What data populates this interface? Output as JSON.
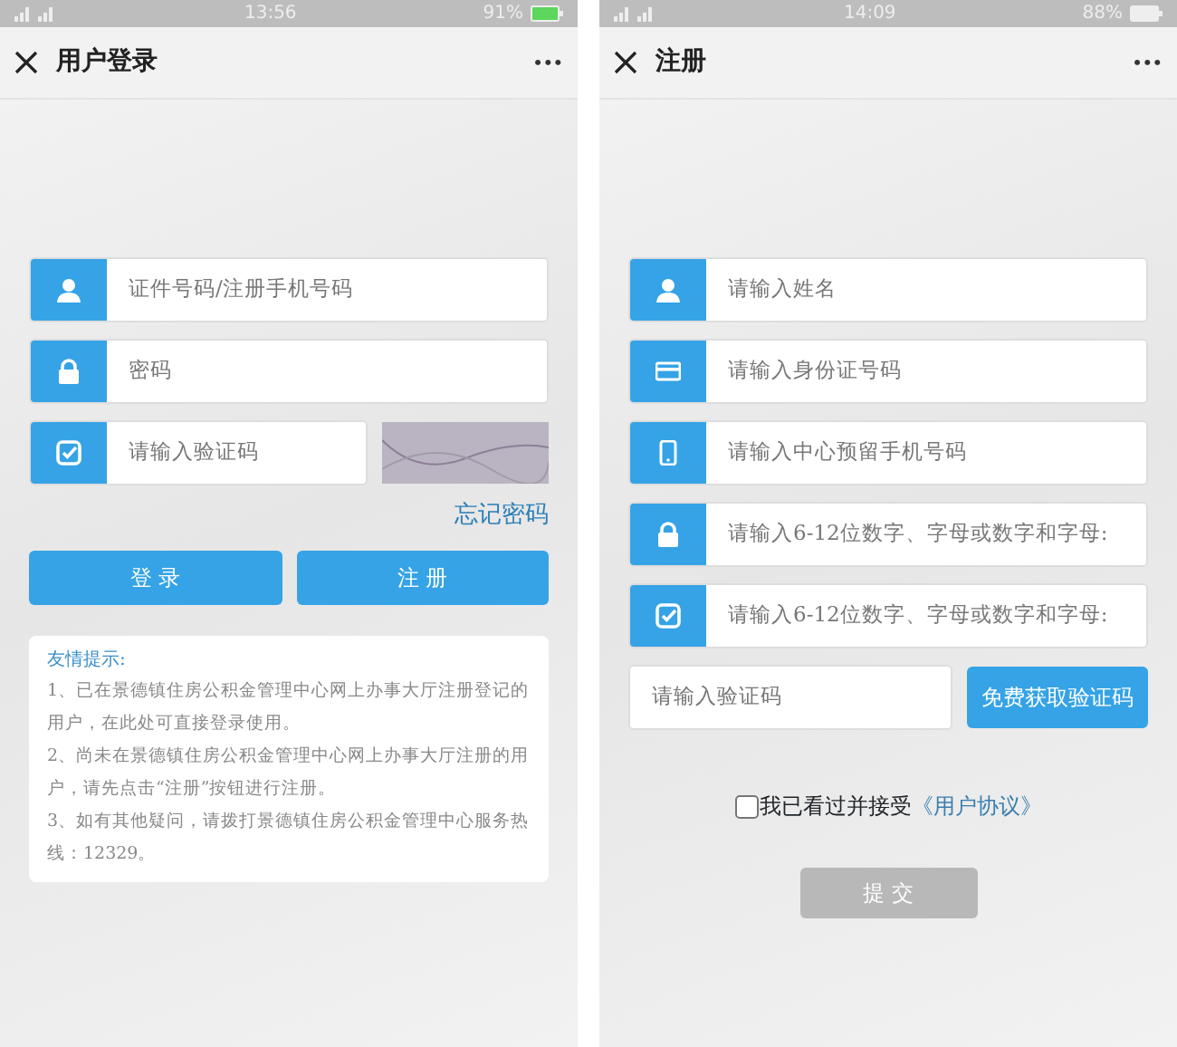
{
  "screens": [
    {
      "status_bar": {
        "time": "13:56",
        "battery": "91%"
      },
      "title": "用户登录",
      "menu": "···",
      "fields": [
        {
          "kind": "user",
          "placeholder": "证件号码/注册手机号码"
        },
        {
          "kind": "lock",
          "placeholder": "密码"
        },
        {
          "kind": "check",
          "placeholder": "请输入验证码",
          "captcha": true
        }
      ],
      "forgot_link": "忘记密码",
      "buttons": [
        {
          "label": "登 录"
        },
        {
          "label": "注 册"
        }
      ],
      "tips": {
        "heading": "友情提示:",
        "lines": [
          "1、已在景德镇住房公积金管理中心网上办事大厅注册登记的用户，在此处可直接登录使用。",
          "2、尚未在景德镇住房公积金管理中心网上办事大厅注册的用户，请先点击“注册”按钮进行注册。",
          "3、如有其他疑问，请拨打景德镇住房公积金管理中心服务热线：12329。"
        ]
      }
    },
    {
      "status_bar": {
        "time": "14:09",
        "battery": "88%"
      },
      "title": "注册",
      "menu": "···",
      "fields": [
        {
          "kind": "user",
          "placeholder": "请输入姓名"
        },
        {
          "kind": "card",
          "placeholder": "请输入身份证号码"
        },
        {
          "kind": "phone",
          "placeholder": "请输入中心预留手机号码"
        },
        {
          "kind": "lock",
          "placeholder": "请输入6-12位数字、字母或数字和字母:"
        },
        {
          "kind": "check",
          "placeholder": "请输入6-12位数字、字母或数字和字母:"
        }
      ],
      "sms": {
        "placeholder": "请输入验证码",
        "button": "免费获取验证码"
      },
      "agreement": {
        "checked": false,
        "text": "我已看过并接受",
        "link": "《用户协议》"
      },
      "submit": {
        "label": "提 交",
        "disabled": true
      }
    }
  ]
}
